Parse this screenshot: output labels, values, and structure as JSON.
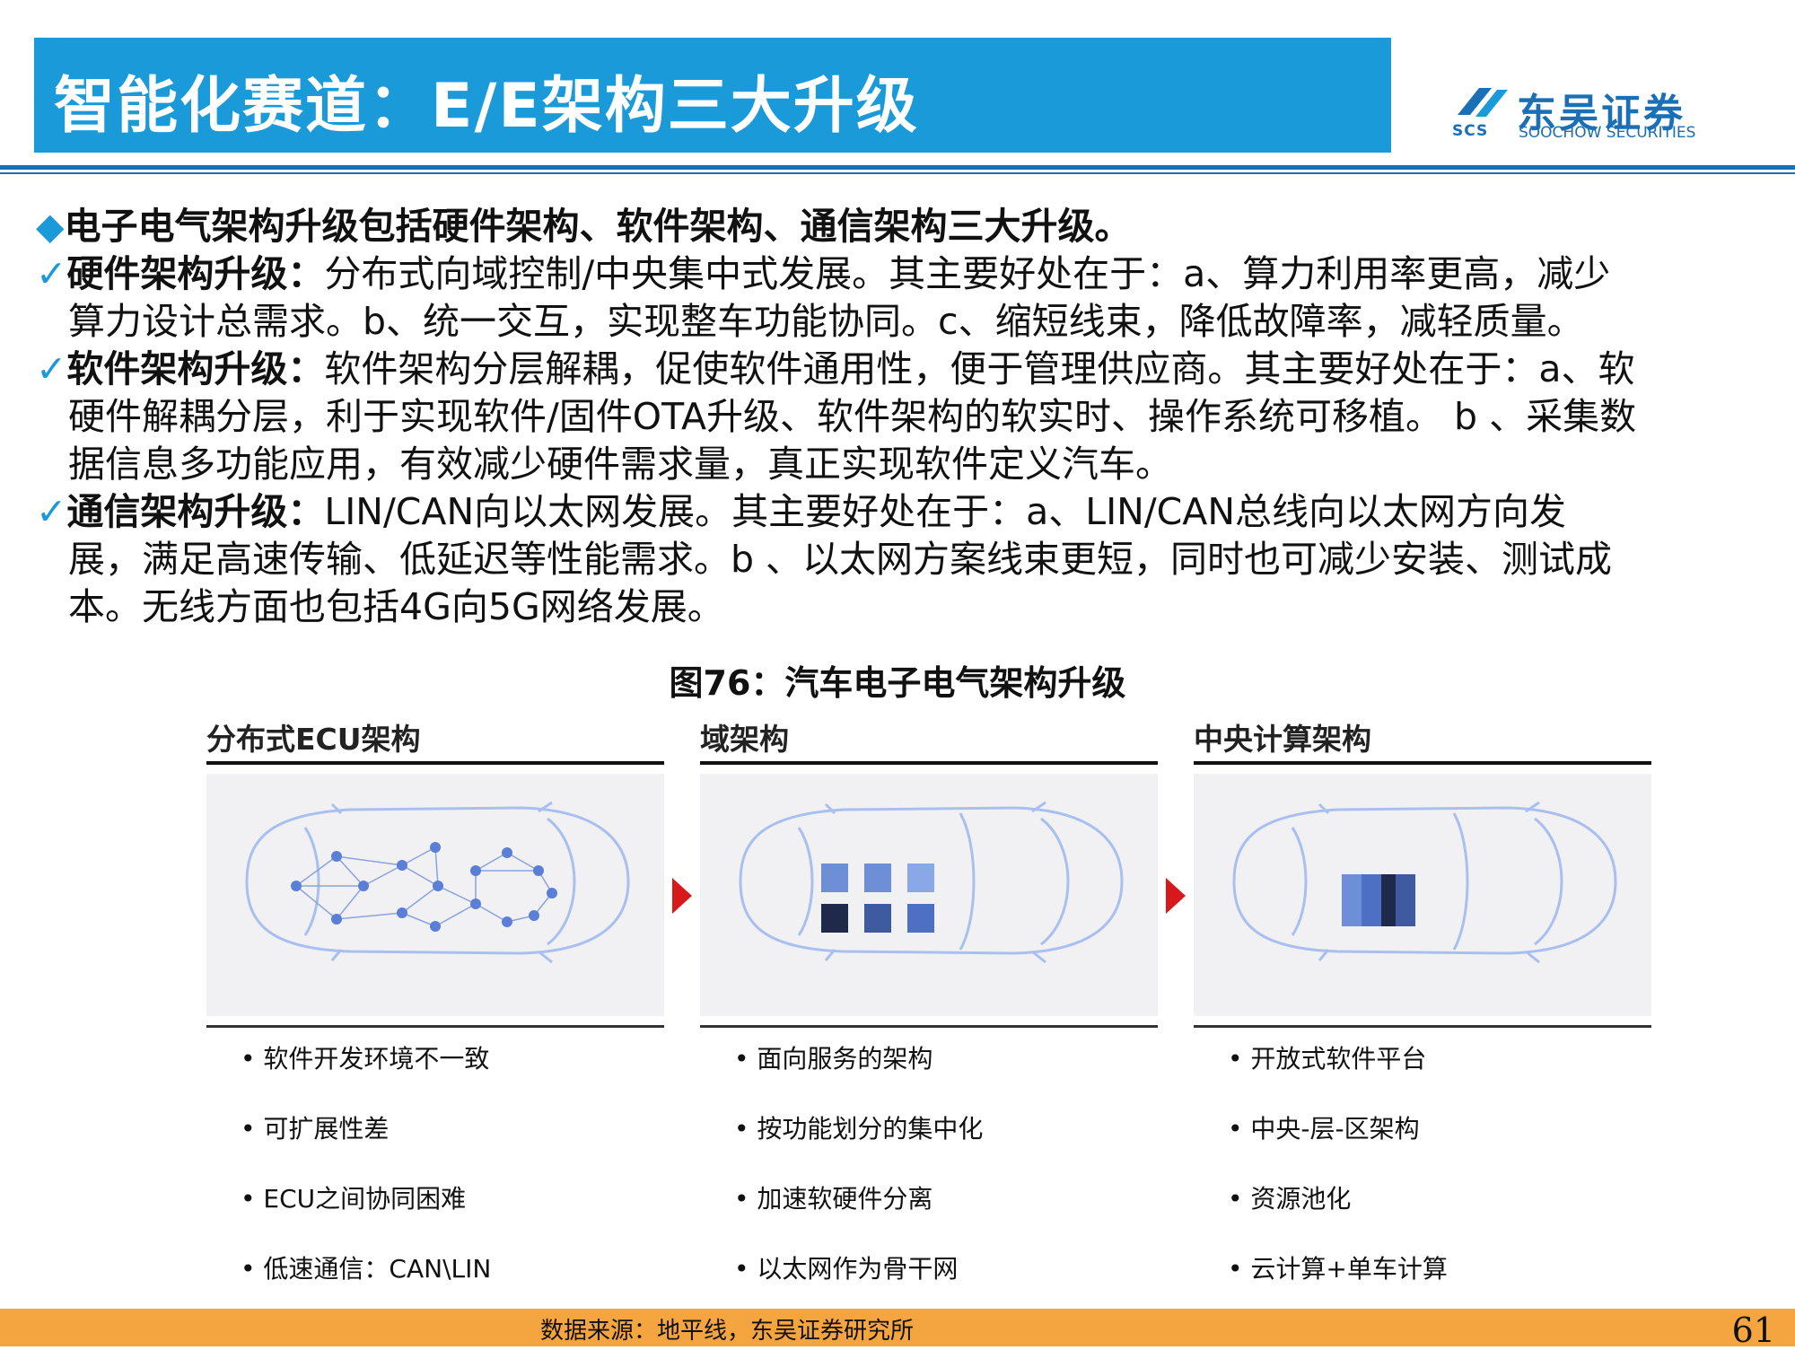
{
  "header": {
    "title": "智能化赛道：E/E架构三大升级",
    "logo_cn": "东吴证券",
    "logo_en": "SOOCHOW SECURITIES",
    "logo_abbr": "SCS"
  },
  "content": {
    "lead": "电子电气架构升级包括硬件架构、软件架构、通信架构三大升级。",
    "items": [
      {
        "label": "硬件架构升级：",
        "lines": [
          "分布式向域控制/中央集中式发展。其主要好处在于：a、算力利用率更高，减少",
          "算力设计总需求。b、统一交互，实现整车功能协同。c、缩短线束，降低故障率，减轻质量。"
        ]
      },
      {
        "label": "软件架构升级：",
        "lines": [
          "软件架构分层解耦，促使软件通用性，便于管理供应商。其主要好处在于：a、软",
          "硬件解耦分层，利于实现软件/固件OTA升级、软件架构的软实时、操作系统可移植。 b 、采集数",
          "据信息多功能应用，有效减少硬件需求量，真正实现软件定义汽车。"
        ]
      },
      {
        "label": "通信架构升级：",
        "lines": [
          "LIN/CAN向以太网发展。其主要好处在于：a、LIN/CAN总线向以太网方向发",
          "展，满足高速传输、低延迟等性能需求。b 、以太网方案线束更短，同时也可减少安装、测试成",
          "本。无线方面也包括4G向5G网络发展。"
        ]
      }
    ]
  },
  "figure": {
    "title": "图76：汽车电子电气架构升级",
    "panels": [
      {
        "heading": "分布式ECU架构",
        "bullets": [
          "软件开发环境不一致",
          "可扩展性差",
          "ECU之间协同困难",
          "低速通信：CAN\\LIN"
        ]
      },
      {
        "heading": "域架构",
        "bullets": [
          "面向服务的架构",
          "按功能划分的集中化",
          "加速软硬件分离",
          "以太网作为骨干网"
        ]
      },
      {
        "heading": "中央计算架构",
        "bullets": [
          "开放式软件平台",
          "中央-层-区架构",
          "资源池化",
          "云计算+单车计算"
        ]
      }
    ]
  },
  "footer": {
    "source": "数据来源：地平线，东吴证券研究所",
    "page": "61"
  },
  "colors": {
    "title_bg": "#1a9ad8",
    "brand": "#1a6fb5",
    "footer_bg": "#f5a540",
    "arrow": "#d7191c"
  }
}
